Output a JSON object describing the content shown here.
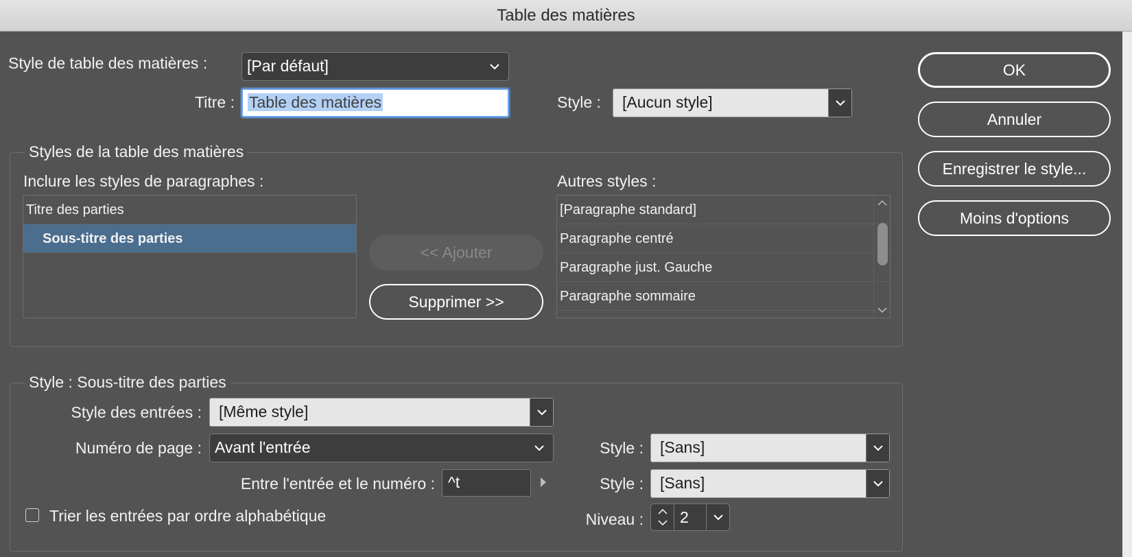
{
  "window": {
    "title": "Table des matières"
  },
  "toc_style": {
    "label": "Style de table des matières :",
    "value": "[Par défaut]"
  },
  "title_field": {
    "label": "Titre :",
    "value": "Table des matières"
  },
  "title_style": {
    "label": "Style :",
    "value": "[Aucun style]"
  },
  "buttons": {
    "ok": "OK",
    "cancel": "Annuler",
    "save_style": "Enregistrer le style...",
    "fewer_options": "Moins d'options",
    "add": "<< Ajouter",
    "remove": "Supprimer >>"
  },
  "styles_group": {
    "title": "Styles de la table des matières",
    "include_label": "Inclure les styles de paragraphes :",
    "include_items": [
      "Titre des parties",
      "Sous-titre des parties"
    ],
    "selected_index": 1,
    "other_label": "Autres styles :",
    "other_items": [
      "[Paragraphe standard]",
      "Paragraphe centré",
      "Paragraphe just. Gauche",
      "Paragraphe sommaire"
    ]
  },
  "style_group": {
    "title": "Style : Sous-titre des parties",
    "entry_style_label": "Style des entrées :",
    "entry_style_value": "[Même style]",
    "page_number_label": "Numéro de page :",
    "page_number_value": "Avant l'entrée",
    "page_number_style_label": "Style :",
    "page_number_style_value": "[Sans]",
    "between_label": "Entre l'entrée et le numéro :",
    "between_value": "^t",
    "between_style_label": "Style :",
    "between_style_value": "[Sans]",
    "sort_label": "Trier les entrées par ordre alphabétique",
    "sort_checked": false,
    "level_label": "Niveau :",
    "level_value": "2"
  },
  "colors": {
    "background": "#535353",
    "selection": "#4b6d8e",
    "focus_ring": "#6aa6f7"
  }
}
